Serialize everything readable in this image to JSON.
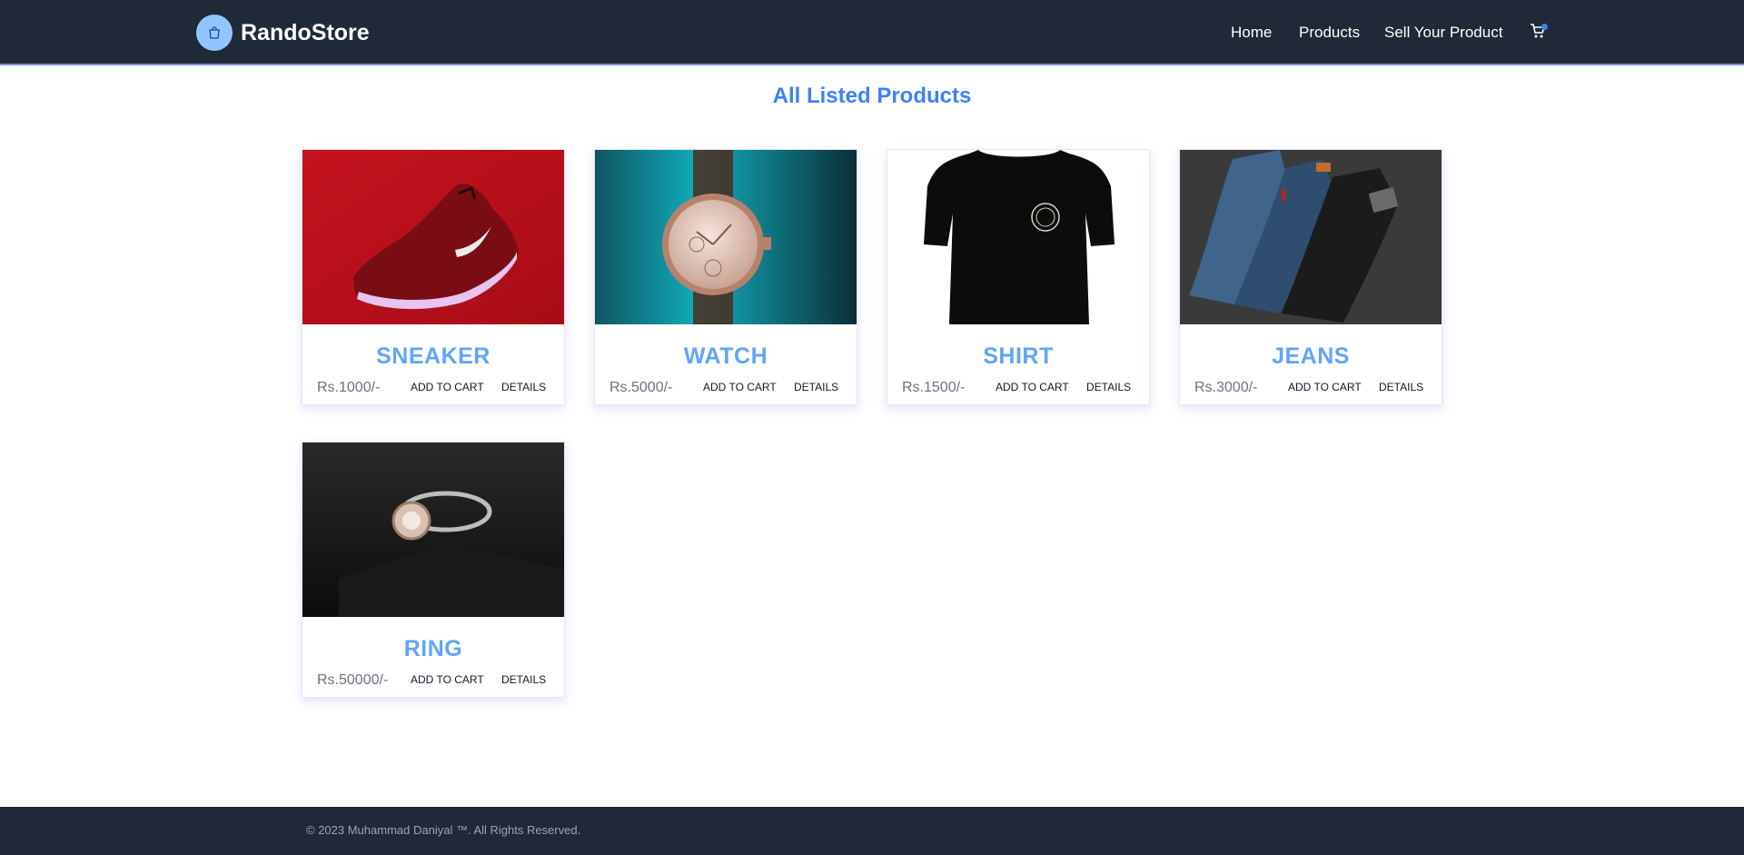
{
  "header": {
    "brand": "RandoStore",
    "nav": [
      {
        "label": "Home"
      },
      {
        "label": "Products"
      },
      {
        "label": "Sell Your Product"
      }
    ]
  },
  "main": {
    "title": "All Listed Products",
    "products": [
      {
        "name": "SNEAKER",
        "price": "Rs.1000/-",
        "add_label": "ADD TO CART",
        "details_label": "DETAILS"
      },
      {
        "name": "WATCH",
        "price": "Rs.5000/-",
        "add_label": "ADD TO CART",
        "details_label": "DETAILS"
      },
      {
        "name": "SHIRT",
        "price": "Rs.1500/-",
        "add_label": "ADD TO CART",
        "details_label": "DETAILS"
      },
      {
        "name": "JEANS",
        "price": "Rs.3000/-",
        "add_label": "ADD TO CART",
        "details_label": "DETAILS"
      },
      {
        "name": "RING",
        "price": "Rs.50000/-",
        "add_label": "ADD TO CART",
        "details_label": "DETAILS"
      }
    ]
  },
  "footer": {
    "text": "© 2023 Muhammad Daniyal ™. All Rights Reserved."
  },
  "colors": {
    "navbar_bg": "#1f2937",
    "accent": "#3b82f6",
    "product_name": "#60a5fa",
    "logo_badge": "#93c5fd"
  },
  "icons": {
    "logo": "shopping-bag-icon",
    "cart": "cart-icon"
  }
}
